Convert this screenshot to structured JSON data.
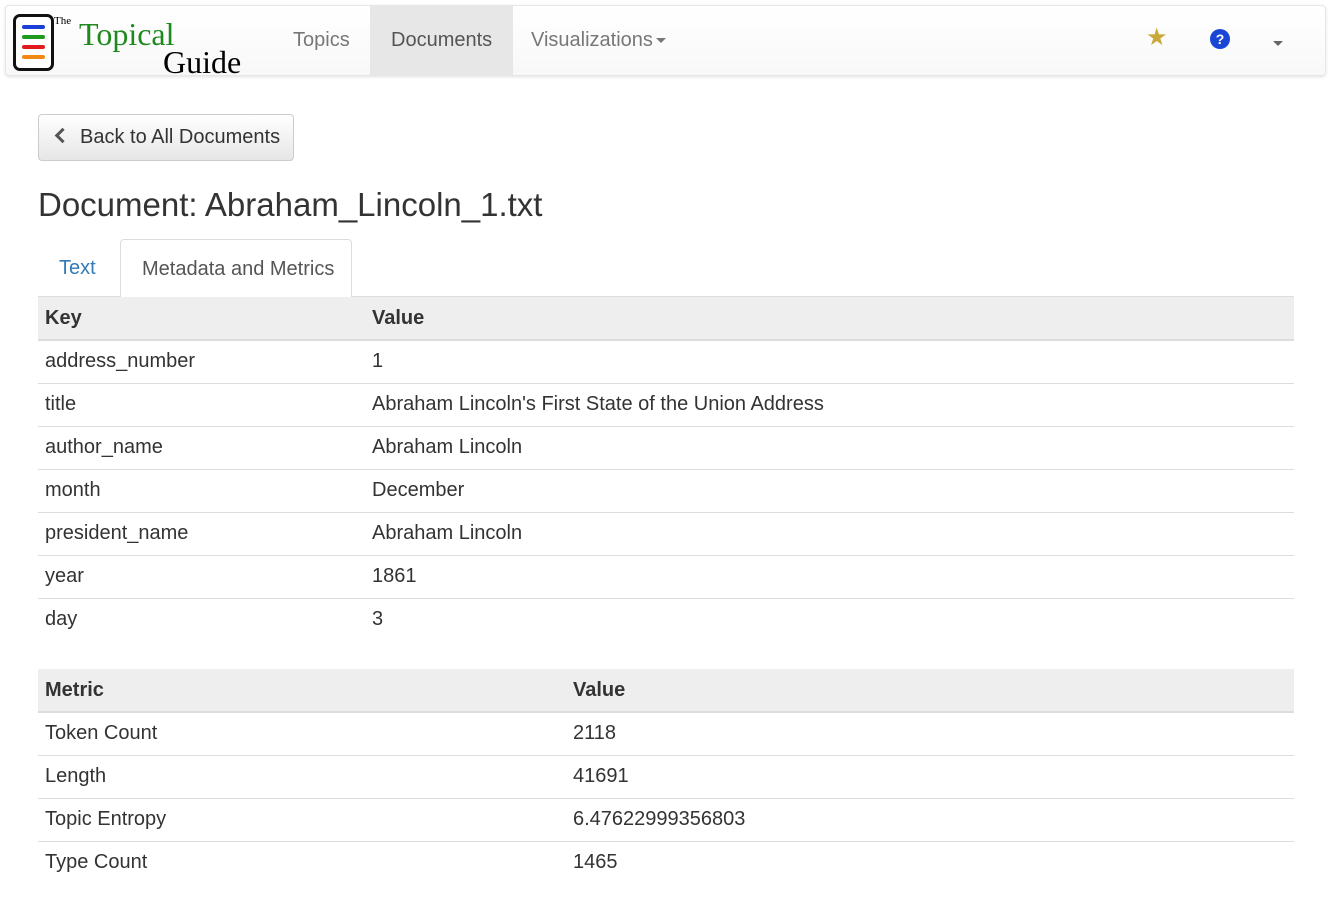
{
  "brand": {
    "the": "The",
    "topical": "Topical",
    "guide": "Guide",
    "icon_colors": [
      "#1b3fd6",
      "#1e9a1e",
      "#e01b1b",
      "#f08a12"
    ]
  },
  "nav": {
    "topics": "Topics",
    "documents": "Documents",
    "visualizations": "Visualizations"
  },
  "icons": {
    "favorites": "star-icon",
    "help": "question-circle-icon",
    "user_menu": "caret-down-icon"
  },
  "back_button": "Back to All Documents",
  "page_title": "Document: Abraham_Lincoln_1.txt",
  "tabs": [
    {
      "label": "Text",
      "active": false
    },
    {
      "label": "Metadata and Metrics",
      "active": true
    }
  ],
  "metadata_table": {
    "headers": [
      "Key",
      "Value"
    ],
    "rows": [
      [
        "address_number",
        "1"
      ],
      [
        "title",
        "Abraham Lincoln's First State of the Union Address"
      ],
      [
        "author_name",
        "Abraham Lincoln"
      ],
      [
        "month",
        "December"
      ],
      [
        "president_name",
        "Abraham Lincoln"
      ],
      [
        "year",
        "1861"
      ],
      [
        "day",
        "3"
      ]
    ]
  },
  "metrics_table": {
    "headers": [
      "Metric",
      "Value"
    ],
    "rows": [
      [
        "Token Count",
        "2118"
      ],
      [
        "Length",
        "41691"
      ],
      [
        "Topic Entropy",
        "6.47622999356803"
      ],
      [
        "Type Count",
        "1465"
      ]
    ]
  },
  "colors": {
    "link": "#337ab7",
    "brand_green": "#1e8a1e",
    "star": "#c8a93a",
    "help": "#1a46d6"
  }
}
